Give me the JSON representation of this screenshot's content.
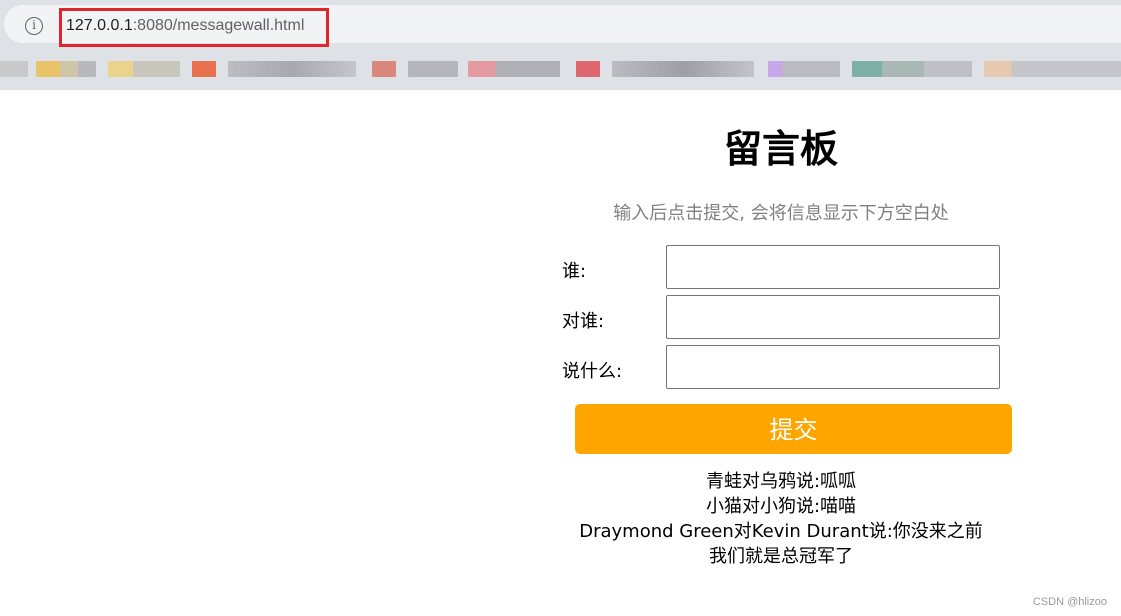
{
  "browser": {
    "url_host": "127.0.0.1",
    "url_path": ":8080/messagewall.html"
  },
  "page": {
    "title": "留言板",
    "subtitle": "输入后点击提交, 会将信息显示下方空白处",
    "form": {
      "who_label": "谁:",
      "to_whom_label": "对谁:",
      "say_label": "说什么:",
      "who_value": "",
      "to_whom_value": "",
      "say_value": "",
      "submit_label": "提交"
    },
    "messages": [
      "青蛙对乌鸦说:呱呱",
      "小猫对小狗说:喵喵",
      "Draymond Green对Kevin Durant说:你没来之前",
      "我们就是总冠军了"
    ]
  },
  "watermark": "CSDN @hlizoo",
  "colors": {
    "submit_bg": "#ffa500",
    "highlight_border": "#e0262b"
  }
}
